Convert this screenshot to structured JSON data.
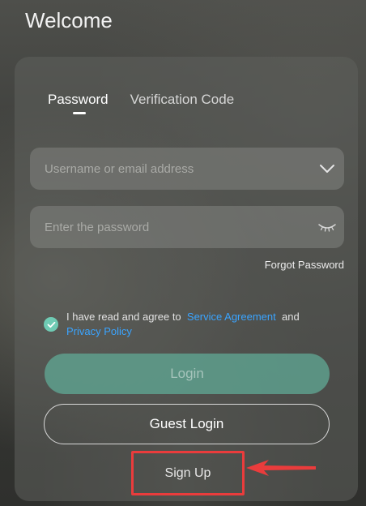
{
  "header": {
    "title": "Welcome"
  },
  "tabs": [
    {
      "label": "Password",
      "active": true
    },
    {
      "label": "Verification Code",
      "active": false
    }
  ],
  "form": {
    "username_placeholder": "Username or email address",
    "password_placeholder": "Enter the password",
    "forgot_label": "Forgot Password"
  },
  "agreement": {
    "checked": true,
    "prefix": "I have read and agree to",
    "service_link": "Service Agreement",
    "conjunction": "and",
    "privacy_link": "Privacy Policy"
  },
  "buttons": {
    "login_label": "Login",
    "guest_label": "Guest Login",
    "signup_label": "Sign Up"
  },
  "icons": {
    "dropdown": "chevron-down-icon",
    "password_visibility": "eye-closed-icon",
    "checkbox": "check-icon",
    "annotation": "red-arrow-icon"
  },
  "colors": {
    "accent": "#6fcbb4",
    "link": "#3aa4ff",
    "highlight": "#ea3c3c"
  }
}
